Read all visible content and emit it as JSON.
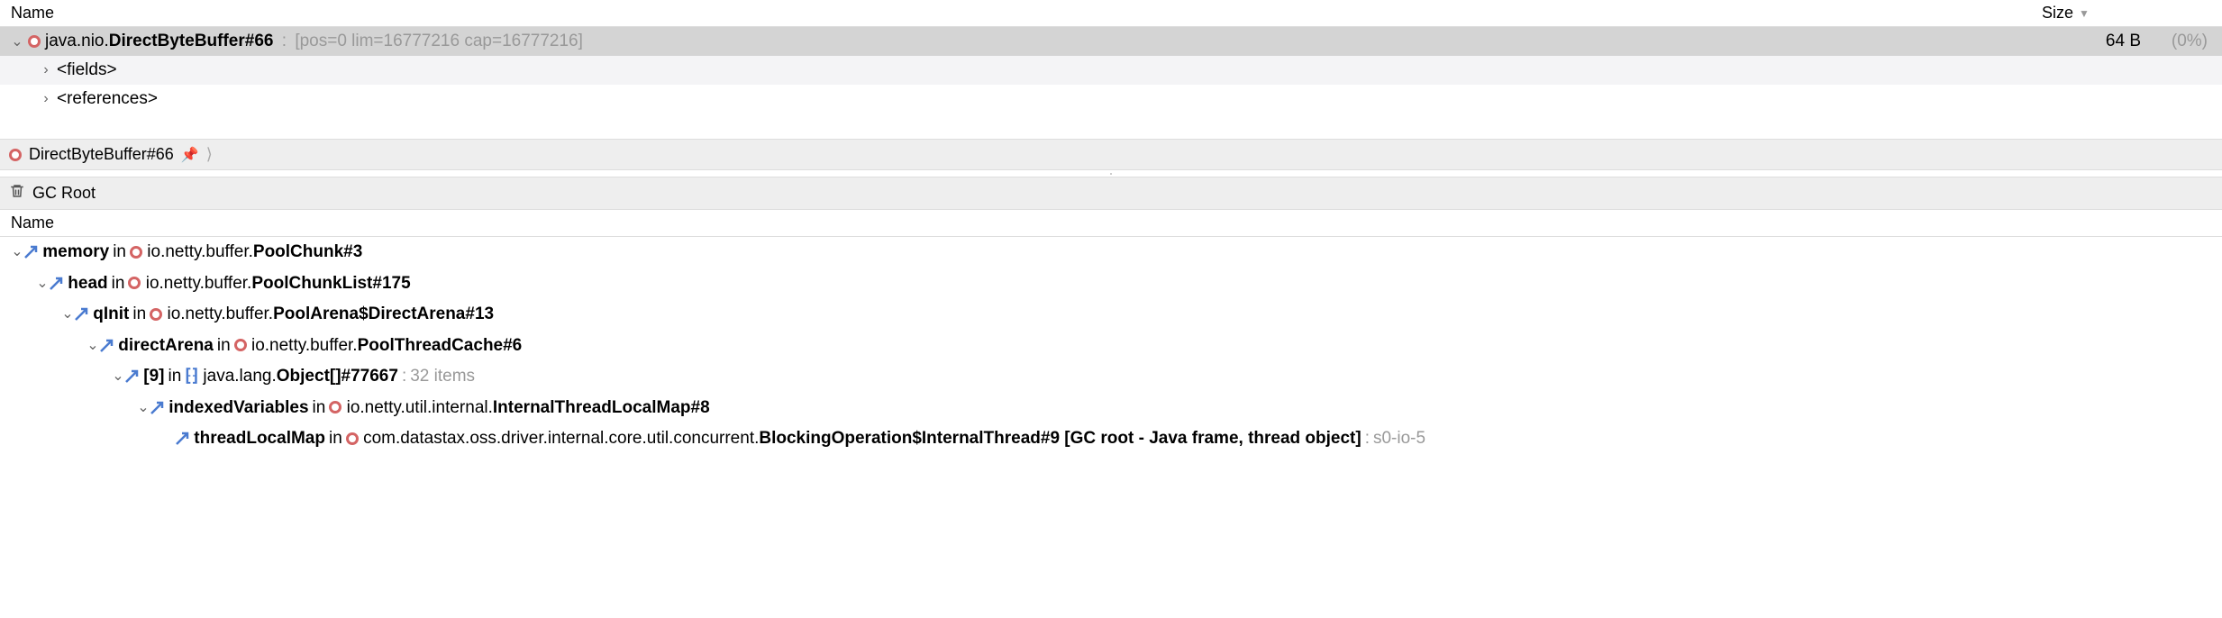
{
  "columns": {
    "name": "Name",
    "size": "Size"
  },
  "top": {
    "row0": {
      "pkg": "java.nio.",
      "cls": "DirectByteBuffer#66",
      "detail": "[pos=0 lim=16777216 cap=16777216]",
      "size": "64 B",
      "pct": "(0%)"
    },
    "fields": "<fields>",
    "references": "<references>"
  },
  "crumb": {
    "label": "DirectByteBuffer#66"
  },
  "gcroot": {
    "label": "GC Root"
  },
  "name2": "Name",
  "tree": {
    "r0": {
      "field": "memory",
      "in": "in",
      "pkg": "io.netty.buffer.",
      "cls": "PoolChunk#3"
    },
    "r1": {
      "field": "head",
      "in": "in",
      "pkg": "io.netty.buffer.",
      "cls": "PoolChunkList#175"
    },
    "r2": {
      "field": "qInit",
      "in": "in",
      "pkg": "io.netty.buffer.",
      "cls": "PoolArena$DirectArena#13"
    },
    "r3": {
      "field": "directArena",
      "in": "in",
      "pkg": "io.netty.buffer.",
      "cls": "PoolThreadCache#6"
    },
    "r4": {
      "field": "[9]",
      "in": "in",
      "pkg": "java.lang.",
      "cls": "Object[]#77667",
      "detail": "32 items"
    },
    "r5": {
      "field": "indexedVariables",
      "in": "in",
      "pkg": "io.netty.util.internal.",
      "cls": "InternalThreadLocalMap#8"
    },
    "r6": {
      "field": "threadLocalMap",
      "in": "in",
      "pkg": "com.datastax.oss.driver.internal.core.util.concurrent.",
      "cls": "BlockingOperation$InternalThread#9 [GC root - Java frame, thread object]",
      "detail": "s0-io-5"
    }
  }
}
